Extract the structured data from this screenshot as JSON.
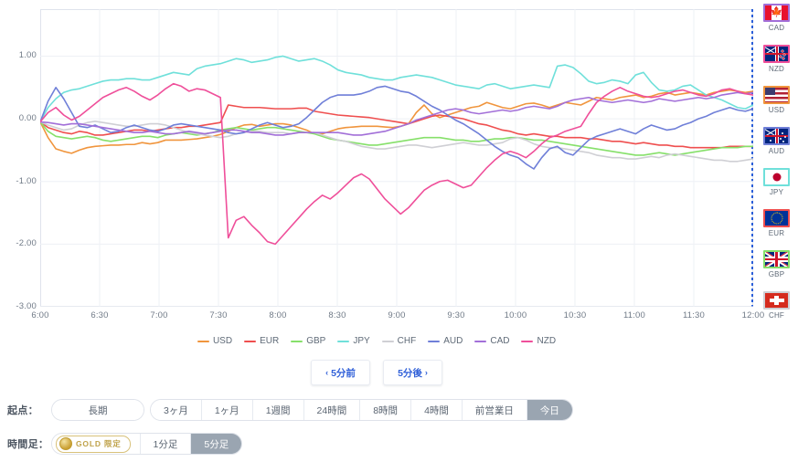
{
  "chart_data": {
    "type": "line",
    "title": "",
    "xlabel": "",
    "ylabel": "",
    "ylim": [
      -3.0,
      1.75
    ],
    "xlim": [
      "6:00",
      "12:00"
    ],
    "grid": true,
    "legend_position": "bottom",
    "y_ticks": [
      "1.00",
      "0.00",
      "-1.00",
      "-2.00",
      "-3.00"
    ],
    "y_tick_values": [
      1.0,
      0.0,
      -1.0,
      -2.0,
      -3.0
    ],
    "x_ticks": [
      "6:00",
      "6:30",
      "7:00",
      "7:30",
      "8:00",
      "8:30",
      "9:00",
      "9:30",
      "10:00",
      "10:30",
      "11:00",
      "11:30",
      "12:00"
    ],
    "series": [
      {
        "name": "USD",
        "color": "#f0953d",
        "values": [
          -0.05,
          -0.3,
          -0.48,
          -0.52,
          -0.55,
          -0.5,
          -0.46,
          -0.44,
          -0.43,
          -0.42,
          -0.42,
          -0.41,
          -0.41,
          -0.38,
          -0.4,
          -0.38,
          -0.34,
          -0.34,
          -0.34,
          -0.33,
          -0.32,
          -0.3,
          -0.28,
          -0.25,
          -0.2,
          -0.14,
          -0.1,
          -0.09,
          -0.12,
          -0.1,
          -0.08,
          -0.08,
          -0.1,
          -0.14,
          -0.18,
          -0.24,
          -0.24,
          -0.2,
          -0.16,
          -0.14,
          -0.13,
          -0.12,
          -0.12,
          -0.12,
          -0.13,
          -0.14,
          -0.12,
          -0.08,
          0.1,
          0.22,
          0.08,
          0.02,
          0.06,
          0.1,
          0.14,
          0.18,
          0.2,
          0.26,
          0.22,
          0.18,
          0.16,
          0.2,
          0.24,
          0.25,
          0.22,
          0.18,
          0.22,
          0.26,
          0.24,
          0.22,
          0.28,
          0.34,
          0.32,
          0.3,
          0.34,
          0.36,
          0.38,
          0.34,
          0.36,
          0.4,
          0.42,
          0.38,
          0.4,
          0.42,
          0.4,
          0.38,
          0.42,
          0.44,
          0.46,
          0.44,
          0.42,
          0.44
        ]
      },
      {
        "name": "EUR",
        "color": "#ef4f4f",
        "values": [
          -0.05,
          -0.14,
          -0.18,
          -0.22,
          -0.24,
          -0.2,
          -0.22,
          -0.26,
          -0.26,
          -0.24,
          -0.22,
          -0.2,
          -0.18,
          -0.18,
          -0.2,
          -0.18,
          -0.16,
          -0.14,
          -0.14,
          -0.12,
          -0.12,
          -0.1,
          -0.08,
          -0.06,
          0.22,
          0.2,
          0.18,
          0.18,
          0.18,
          0.17,
          0.16,
          0.16,
          0.16,
          0.17,
          0.17,
          0.12,
          0.1,
          0.08,
          0.06,
          0.05,
          0.04,
          0.03,
          0.02,
          0.0,
          -0.02,
          -0.04,
          -0.06,
          -0.08,
          -0.04,
          0.0,
          0.04,
          0.06,
          0.04,
          0.02,
          0.0,
          -0.04,
          -0.08,
          -0.1,
          -0.14,
          -0.18,
          -0.2,
          -0.24,
          -0.26,
          -0.24,
          -0.26,
          -0.28,
          -0.28,
          -0.3,
          -0.3,
          -0.3,
          -0.32,
          -0.32,
          -0.34,
          -0.36,
          -0.36,
          -0.38,
          -0.4,
          -0.38,
          -0.4,
          -0.42,
          -0.42,
          -0.44,
          -0.44,
          -0.46,
          -0.46,
          -0.46,
          -0.46,
          -0.46,
          -0.44,
          -0.44,
          -0.44,
          -0.44
        ]
      },
      {
        "name": "GBP",
        "color": "#86e06a",
        "values": [
          -0.05,
          -0.2,
          -0.28,
          -0.3,
          -0.32,
          -0.3,
          -0.28,
          -0.3,
          -0.34,
          -0.36,
          -0.34,
          -0.32,
          -0.3,
          -0.28,
          -0.28,
          -0.3,
          -0.26,
          -0.24,
          -0.22,
          -0.24,
          -0.26,
          -0.24,
          -0.22,
          -0.18,
          -0.16,
          -0.14,
          -0.16,
          -0.18,
          -0.16,
          -0.14,
          -0.14,
          -0.16,
          -0.18,
          -0.2,
          -0.22,
          -0.24,
          -0.28,
          -0.32,
          -0.34,
          -0.36,
          -0.38,
          -0.4,
          -0.42,
          -0.42,
          -0.4,
          -0.38,
          -0.36,
          -0.34,
          -0.32,
          -0.3,
          -0.3,
          -0.3,
          -0.32,
          -0.34,
          -0.34,
          -0.36,
          -0.36,
          -0.34,
          -0.32,
          -0.32,
          -0.3,
          -0.3,
          -0.32,
          -0.34,
          -0.34,
          -0.36,
          -0.38,
          -0.4,
          -0.42,
          -0.44,
          -0.46,
          -0.48,
          -0.5,
          -0.52,
          -0.54,
          -0.56,
          -0.58,
          -0.58,
          -0.56,
          -0.54,
          -0.56,
          -0.58,
          -0.56,
          -0.54,
          -0.52,
          -0.5,
          -0.48,
          -0.46,
          -0.46,
          -0.46,
          -0.44,
          -0.44
        ]
      },
      {
        "name": "JPY",
        "color": "#6fe0da",
        "values": [
          -0.05,
          0.18,
          0.32,
          0.42,
          0.46,
          0.48,
          0.52,
          0.56,
          0.6,
          0.62,
          0.62,
          0.64,
          0.64,
          0.62,
          0.62,
          0.66,
          0.7,
          0.74,
          0.72,
          0.7,
          0.8,
          0.84,
          0.86,
          0.88,
          0.92,
          0.96,
          0.94,
          0.9,
          0.92,
          0.94,
          0.98,
          1.0,
          0.96,
          0.92,
          0.94,
          0.96,
          0.92,
          0.86,
          0.78,
          0.74,
          0.72,
          0.7,
          0.66,
          0.64,
          0.62,
          0.62,
          0.66,
          0.68,
          0.7,
          0.68,
          0.66,
          0.62,
          0.58,
          0.54,
          0.52,
          0.5,
          0.48,
          0.54,
          0.56,
          0.52,
          0.48,
          0.5,
          0.52,
          0.54,
          0.52,
          0.5,
          0.84,
          0.86,
          0.82,
          0.72,
          0.6,
          0.56,
          0.58,
          0.62,
          0.6,
          0.56,
          0.7,
          0.74,
          0.58,
          0.46,
          0.44,
          0.46,
          0.52,
          0.54,
          0.46,
          0.38,
          0.34,
          0.3,
          0.24,
          0.18,
          0.16,
          0.22
        ]
      },
      {
        "name": "CHF",
        "color": "#cfcfd4",
        "values": [
          -0.05,
          -0.1,
          -0.14,
          -0.18,
          -0.16,
          -0.1,
          -0.06,
          -0.04,
          -0.06,
          -0.08,
          -0.1,
          -0.12,
          -0.12,
          -0.1,
          -0.08,
          -0.08,
          -0.1,
          -0.14,
          -0.18,
          -0.22,
          -0.24,
          -0.26,
          -0.28,
          -0.3,
          -0.28,
          -0.24,
          -0.22,
          -0.2,
          -0.2,
          -0.22,
          -0.22,
          -0.22,
          -0.24,
          -0.22,
          -0.22,
          -0.22,
          -0.26,
          -0.3,
          -0.34,
          -0.36,
          -0.4,
          -0.44,
          -0.46,
          -0.48,
          -0.48,
          -0.46,
          -0.44,
          -0.42,
          -0.42,
          -0.44,
          -0.46,
          -0.44,
          -0.42,
          -0.4,
          -0.38,
          -0.4,
          -0.42,
          -0.42,
          -0.4,
          -0.38,
          -0.32,
          -0.3,
          -0.34,
          -0.4,
          -0.44,
          -0.46,
          -0.46,
          -0.48,
          -0.5,
          -0.52,
          -0.54,
          -0.58,
          -0.6,
          -0.62,
          -0.62,
          -0.64,
          -0.64,
          -0.62,
          -0.6,
          -0.62,
          -0.58,
          -0.56,
          -0.58,
          -0.6,
          -0.62,
          -0.64,
          -0.66,
          -0.66,
          -0.68,
          -0.68,
          -0.66,
          -0.64
        ]
      },
      {
        "name": "AUD",
        "color": "#6f7fd8",
        "values": [
          -0.05,
          0.28,
          0.5,
          0.32,
          0.1,
          -0.12,
          -0.14,
          -0.1,
          -0.16,
          -0.22,
          -0.2,
          -0.14,
          -0.1,
          -0.14,
          -0.18,
          -0.2,
          -0.16,
          -0.1,
          -0.08,
          -0.1,
          -0.12,
          -0.14,
          -0.16,
          -0.18,
          -0.22,
          -0.24,
          -0.22,
          -0.16,
          -0.1,
          -0.06,
          -0.1,
          -0.14,
          -0.12,
          -0.08,
          0.02,
          0.14,
          0.26,
          0.34,
          0.38,
          0.38,
          0.38,
          0.4,
          0.44,
          0.5,
          0.52,
          0.48,
          0.44,
          0.42,
          0.36,
          0.28,
          0.2,
          0.14,
          0.06,
          -0.02,
          -0.08,
          -0.16,
          -0.24,
          -0.34,
          -0.44,
          -0.52,
          -0.58,
          -0.62,
          -0.72,
          -0.8,
          -0.62,
          -0.48,
          -0.44,
          -0.54,
          -0.58,
          -0.46,
          -0.34,
          -0.28,
          -0.24,
          -0.2,
          -0.16,
          -0.2,
          -0.24,
          -0.16,
          -0.1,
          -0.14,
          -0.18,
          -0.16,
          -0.1,
          -0.06,
          0.0,
          0.04,
          0.1,
          0.14,
          0.18,
          0.14,
          0.12,
          0.16
        ]
      },
      {
        "name": "CAD",
        "color": "#a26fd8",
        "values": [
          -0.05,
          -0.06,
          -0.08,
          -0.1,
          -0.08,
          -0.08,
          -0.1,
          -0.12,
          -0.14,
          -0.16,
          -0.18,
          -0.2,
          -0.22,
          -0.22,
          -0.2,
          -0.22,
          -0.24,
          -0.24,
          -0.22,
          -0.2,
          -0.22,
          -0.24,
          -0.22,
          -0.2,
          -0.18,
          -0.18,
          -0.2,
          -0.22,
          -0.22,
          -0.24,
          -0.26,
          -0.26,
          -0.24,
          -0.22,
          -0.22,
          -0.22,
          -0.22,
          -0.22,
          -0.22,
          -0.24,
          -0.26,
          -0.26,
          -0.24,
          -0.22,
          -0.2,
          -0.16,
          -0.12,
          -0.08,
          -0.02,
          0.02,
          0.06,
          0.1,
          0.14,
          0.16,
          0.14,
          0.1,
          0.08,
          0.1,
          0.12,
          0.14,
          0.12,
          0.14,
          0.18,
          0.2,
          0.18,
          0.16,
          0.2,
          0.26,
          0.3,
          0.32,
          0.34,
          0.3,
          0.28,
          0.26,
          0.28,
          0.3,
          0.28,
          0.26,
          0.28,
          0.32,
          0.3,
          0.28,
          0.3,
          0.32,
          0.34,
          0.32,
          0.34,
          0.38,
          0.4,
          0.42,
          0.4,
          0.42
        ]
      },
      {
        "name": "NZD",
        "color": "#ef4f9a",
        "values": [
          -0.05,
          0.1,
          0.18,
          0.06,
          -0.02,
          0.04,
          0.14,
          0.24,
          0.34,
          0.4,
          0.46,
          0.5,
          0.44,
          0.36,
          0.3,
          0.38,
          0.48,
          0.56,
          0.52,
          0.44,
          0.48,
          0.46,
          0.4,
          0.34,
          -1.9,
          -1.62,
          -1.56,
          -1.7,
          -1.82,
          -1.96,
          -2.0,
          -1.86,
          -1.72,
          -1.58,
          -1.44,
          -1.32,
          -1.22,
          -1.28,
          -1.18,
          -1.06,
          -0.94,
          -0.88,
          -0.96,
          -1.12,
          -1.28,
          -1.4,
          -1.52,
          -1.42,
          -1.28,
          -1.14,
          -1.06,
          -1.0,
          -0.98,
          -1.04,
          -1.1,
          -1.06,
          -0.92,
          -0.78,
          -0.66,
          -0.56,
          -0.52,
          -0.56,
          -0.62,
          -0.52,
          -0.4,
          -0.3,
          -0.26,
          -0.2,
          -0.16,
          -0.12,
          0.08,
          0.26,
          0.36,
          0.44,
          0.5,
          0.44,
          0.4,
          0.36,
          0.34,
          0.36,
          0.4,
          0.44,
          0.46,
          0.42,
          0.38,
          0.36,
          0.4,
          0.46,
          0.48,
          0.44,
          0.4,
          0.38
        ]
      }
    ]
  },
  "flags": {
    "items": [
      {
        "code": "CAD",
        "icon": "flag-ca-icon",
        "border": "#a26fd8"
      },
      {
        "code": "NZD",
        "icon": "flag-nz-icon",
        "border": "#ef4f9a"
      },
      {
        "code": "USD",
        "icon": "flag-us-icon",
        "border": "#f0953d"
      },
      {
        "code": "AUD",
        "icon": "flag-au-icon",
        "border": "#6f7fd8"
      },
      {
        "code": "JPY",
        "icon": "flag-jp-icon",
        "border": "#6fe0da"
      },
      {
        "code": "EUR",
        "icon": "flag-eu-icon",
        "border": "#ef4f4f"
      },
      {
        "code": "GBP",
        "icon": "flag-gb-icon",
        "border": "#86e06a"
      },
      {
        "code": "CHF",
        "icon": "flag-ch-icon",
        "border": "#cfcfd4"
      }
    ]
  },
  "nav": {
    "prev_label": "5分前",
    "prev_caret": "‹",
    "next_label": "5分後",
    "next_caret": "›"
  },
  "origin_row": {
    "label": "起点：",
    "detached": {
      "label": "長期",
      "active": false
    },
    "options": [
      {
        "label": "3ヶ月",
        "active": false
      },
      {
        "label": "1ヶ月",
        "active": false
      },
      {
        "label": "1週間",
        "active": false
      },
      {
        "label": "24時間",
        "active": false
      },
      {
        "label": "8時間",
        "active": false
      },
      {
        "label": "4時間",
        "active": false
      },
      {
        "label": "前営業日",
        "active": false
      },
      {
        "label": "今日",
        "active": true
      }
    ]
  },
  "timeframe_row": {
    "label": "時間足：",
    "gold_badge": "GOLD 限定",
    "options": [
      {
        "label": "1分足",
        "active": false
      },
      {
        "label": "5分足",
        "active": true
      }
    ]
  },
  "colors": {
    "active_pill_bg": "#9aa5b1",
    "link_blue": "#2f5fd8",
    "grid": "#eef0f5",
    "axis_border": "#dfe3ec",
    "gold": "#bfa24a"
  }
}
